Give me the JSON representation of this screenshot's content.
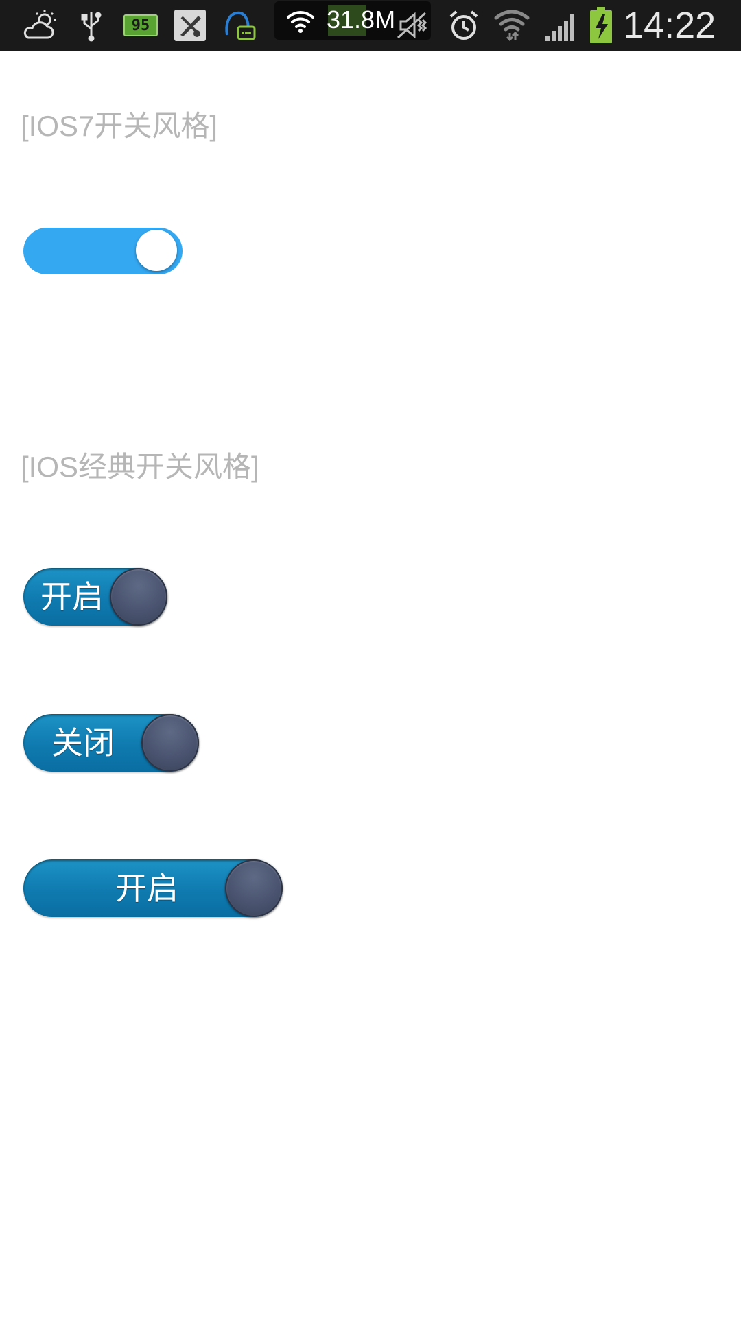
{
  "status_bar": {
    "icons": [
      "weather-icon",
      "usb-icon",
      "battery-badge-icon",
      "app-notification-icon",
      "chat-notification-icon"
    ],
    "badge_value": "95",
    "network_speed": "31.8M",
    "clock": "14:22",
    "right_icons": [
      "mute-icon",
      "alarm-icon",
      "wifi-icon",
      "signal-icon",
      "battery-charging-icon"
    ]
  },
  "sections": {
    "ios7": {
      "label": "[IOS7开关风格]",
      "toggle_state": "on",
      "accent_color": "#35a8f2"
    },
    "classic": {
      "label": "[IOS经典开关风格]",
      "toggles": [
        {
          "label": "开启",
          "state": "on"
        },
        {
          "label": "关闭",
          "state": "off"
        },
        {
          "label": "开启",
          "state": "on"
        }
      ],
      "track_color": "#0f7aaf",
      "knob_color": "#4a5470"
    }
  }
}
